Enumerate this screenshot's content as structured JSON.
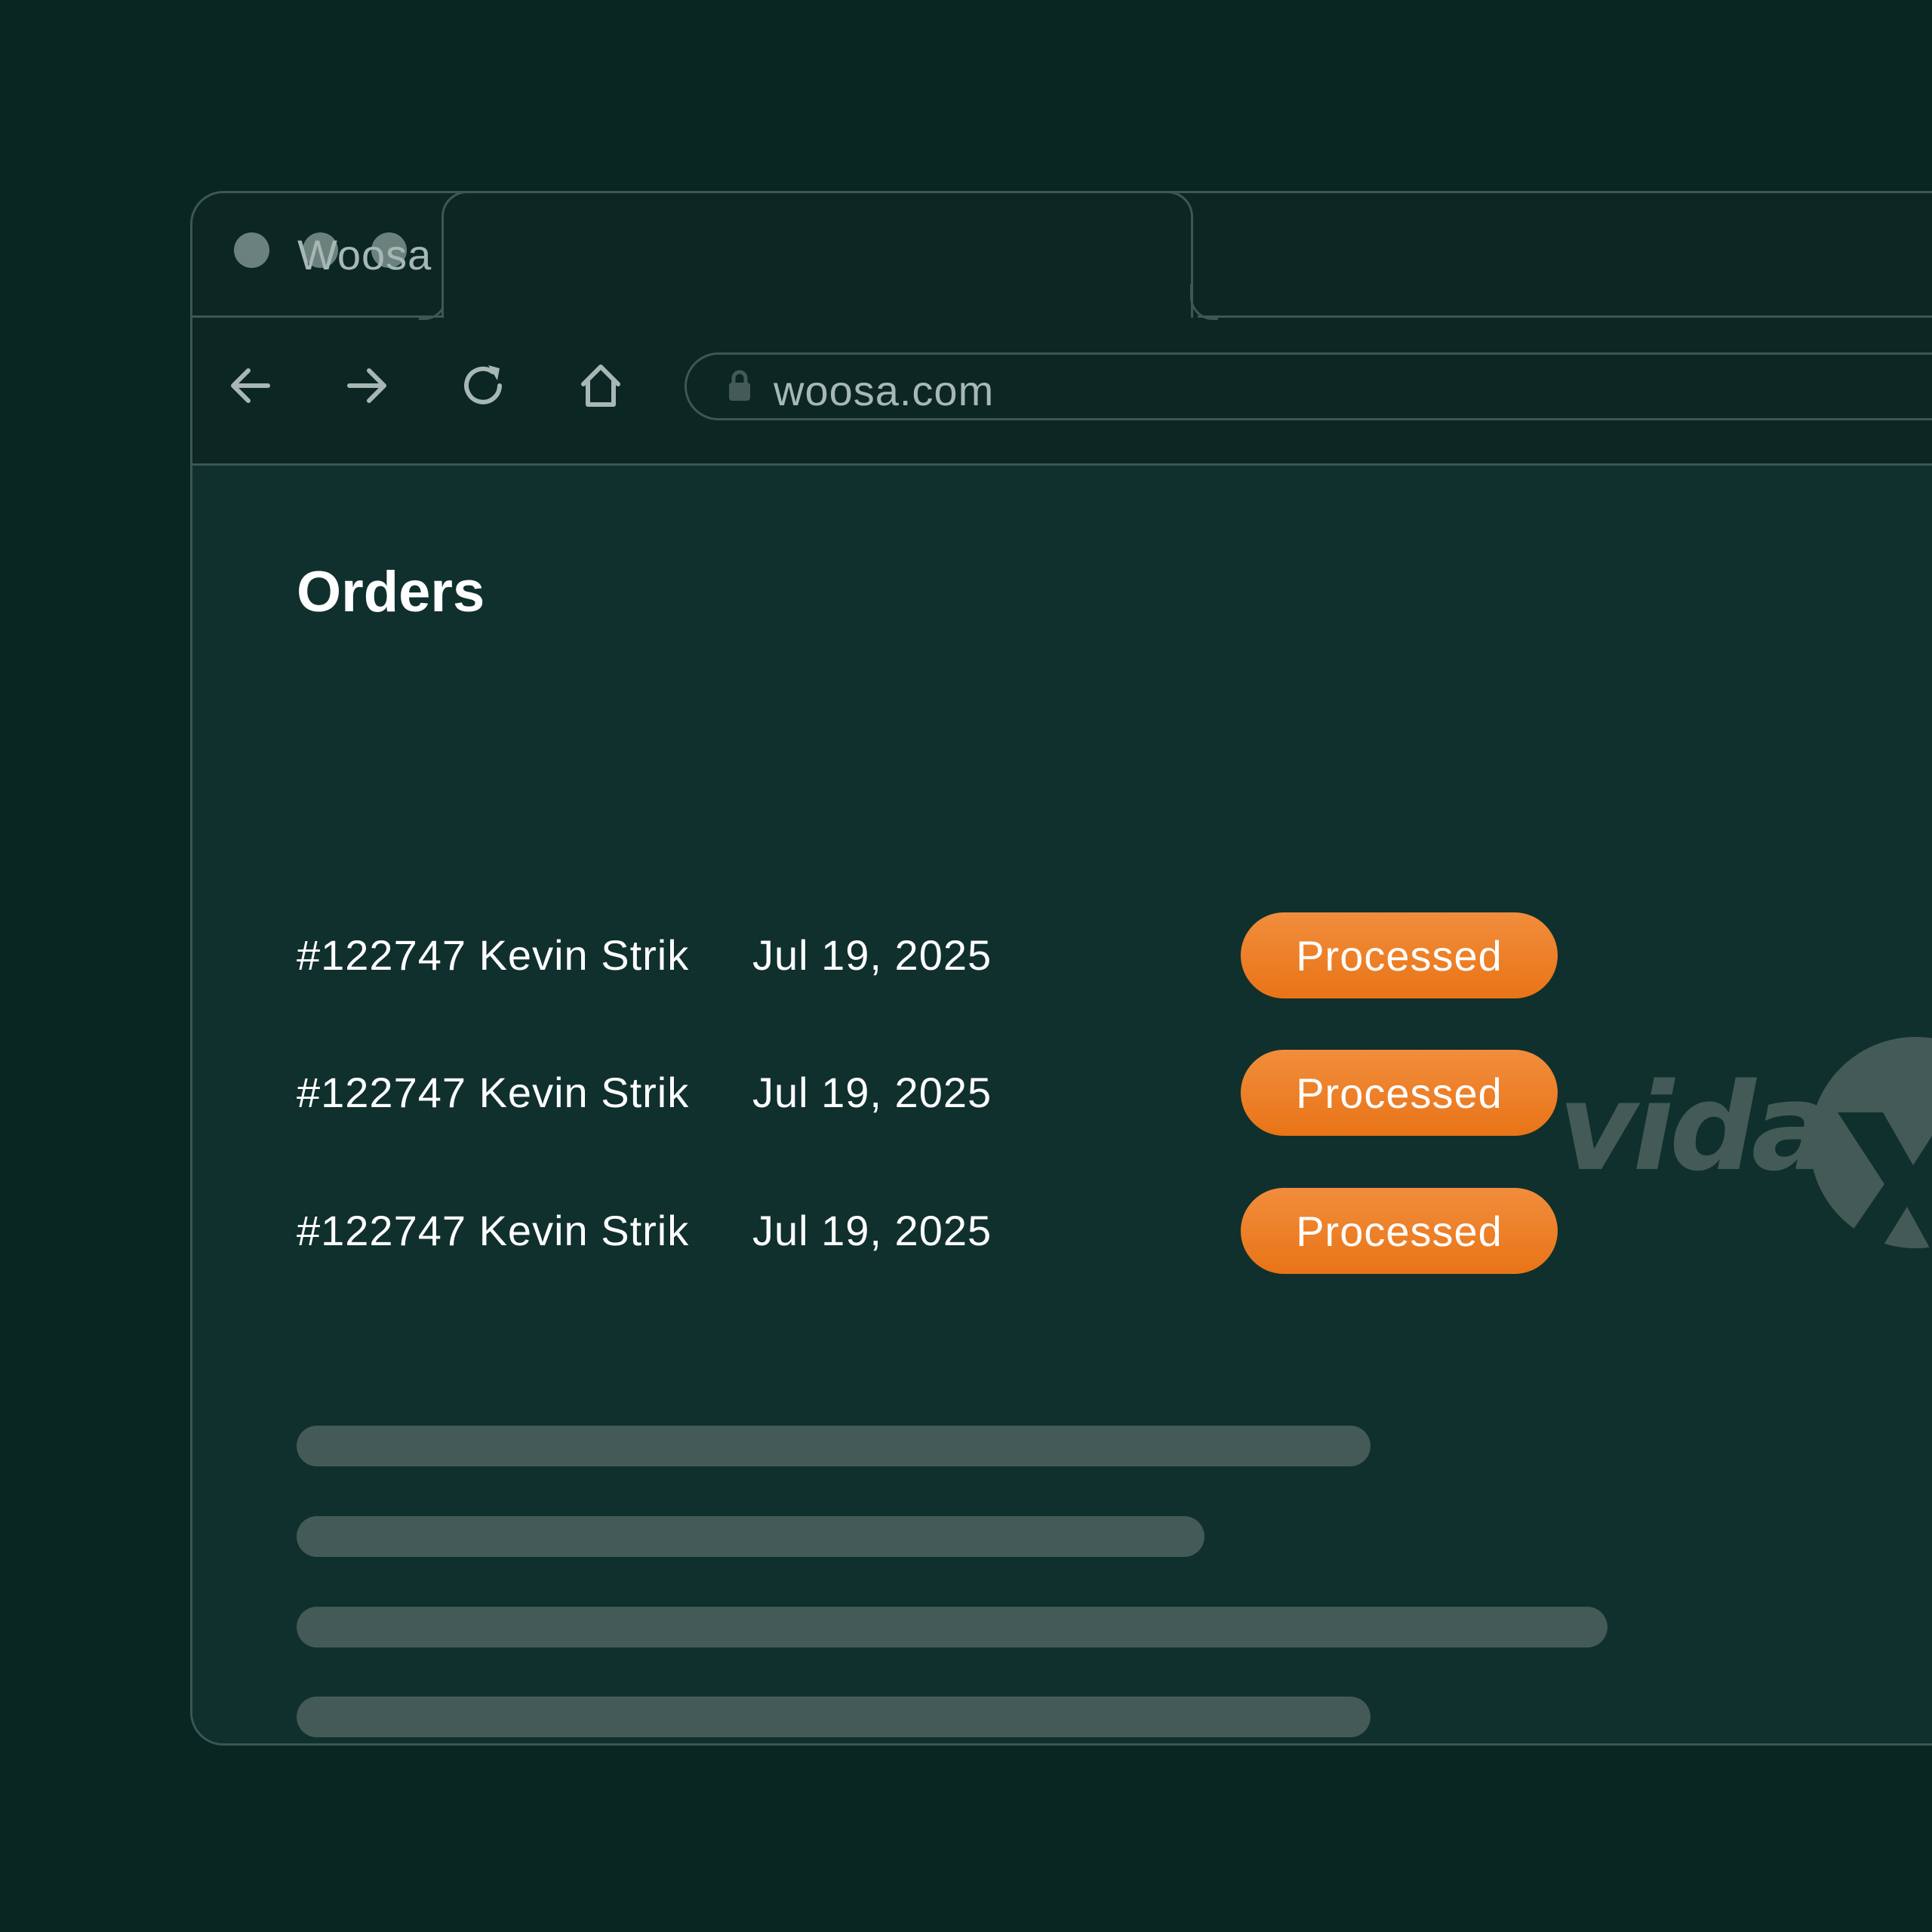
{
  "browser": {
    "tab_title": "Woosa",
    "url": "woosa.com"
  },
  "page": {
    "title": "Orders"
  },
  "logo": {
    "text": "vidaXL"
  },
  "orders": [
    {
      "id": "#122747 Kevin Strik",
      "date": "Jul 19, 2025",
      "status": "Processed"
    },
    {
      "id": "#122747 Kevin Strik",
      "date": "Jul 19, 2025",
      "status": "Processed"
    },
    {
      "id": "#122747 Kevin Strik",
      "date": "Jul 19, 2025",
      "status": "Processed"
    }
  ],
  "colors": {
    "background": "#0a2622",
    "content": "#10302d",
    "status_accent": "#ef7f26",
    "skeleton": "#445a57"
  },
  "icons": {
    "back": "arrow-left-icon",
    "forward": "arrow-right-icon",
    "reload": "reload-icon",
    "home": "home-icon",
    "lock": "lock-icon"
  }
}
